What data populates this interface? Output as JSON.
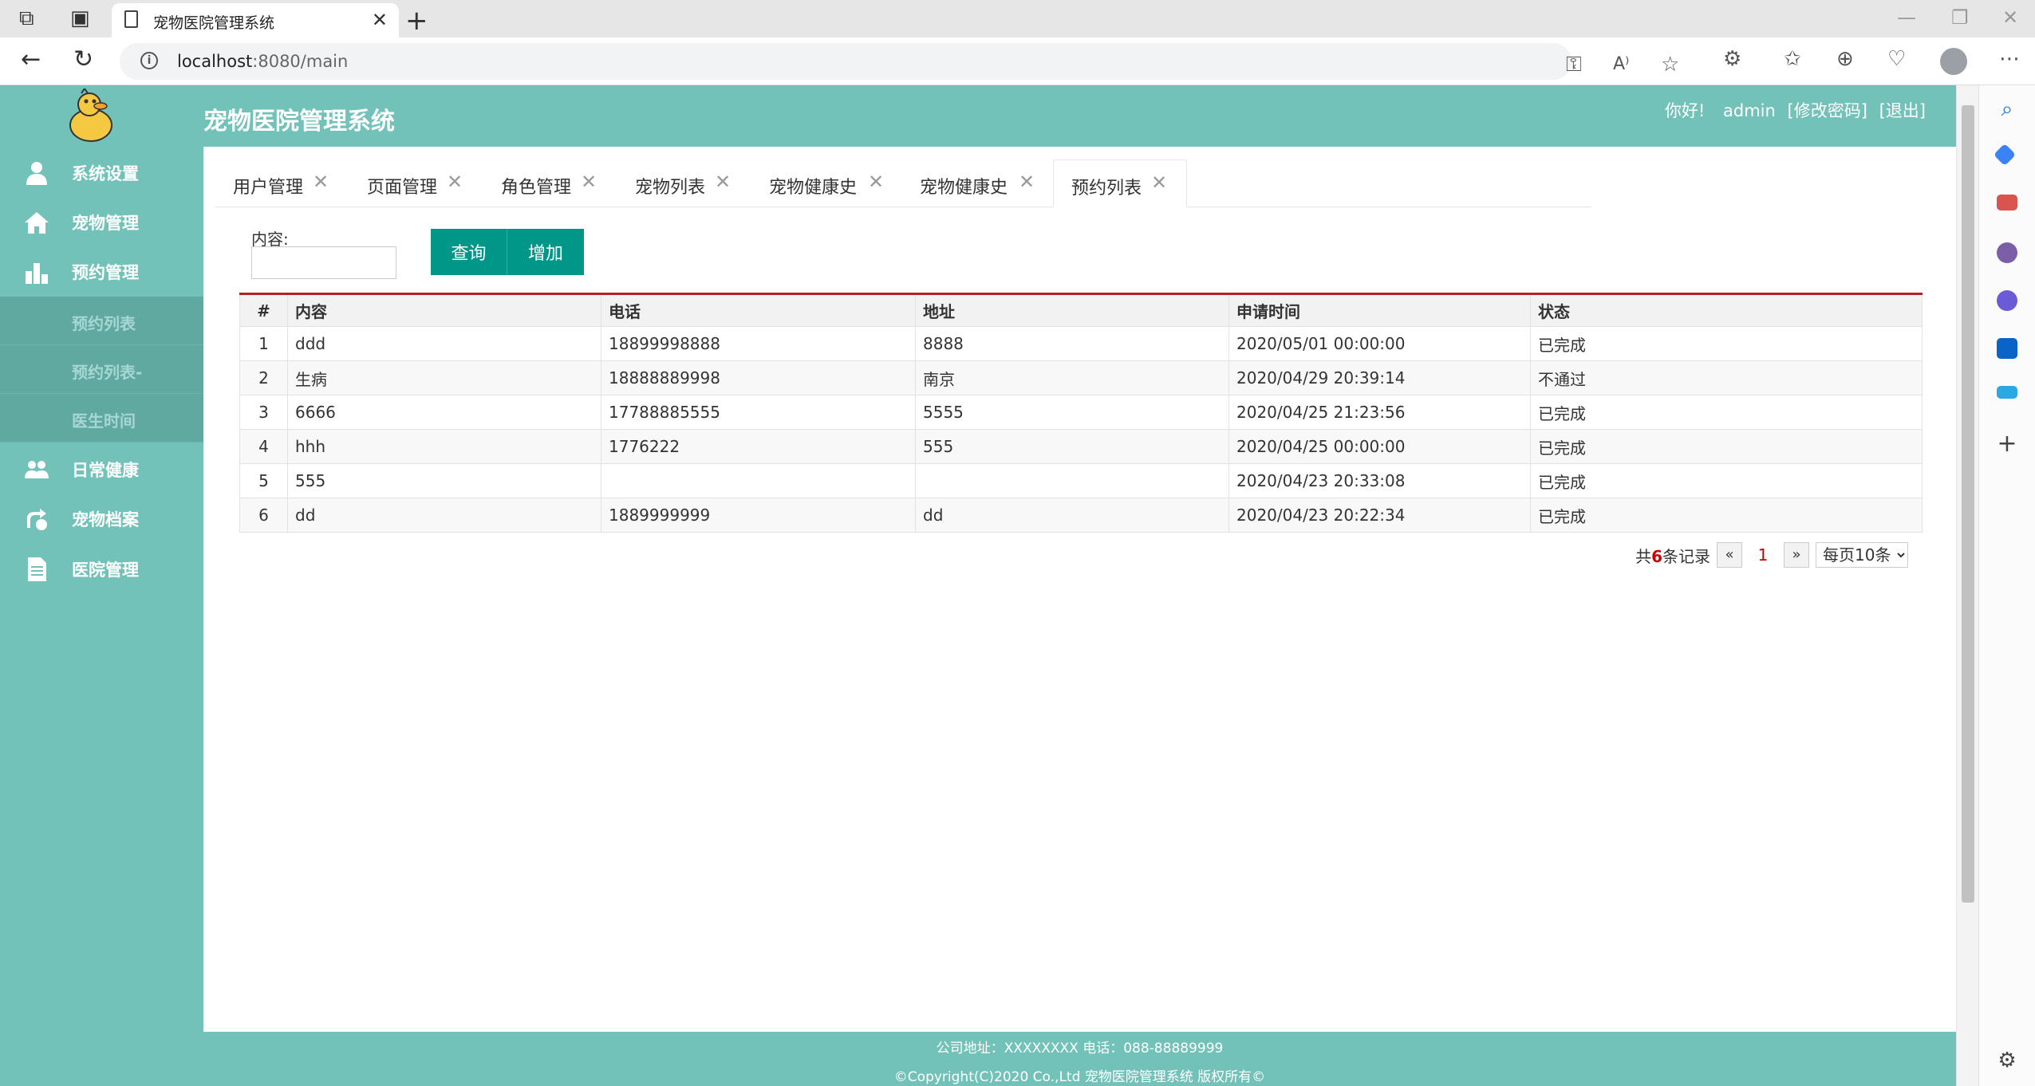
{
  "browser": {
    "tab_title": "宠物医院管理系统",
    "url_host": "localhost",
    "url_rest": ":8080/main"
  },
  "app": {
    "title": "宠物医院管理系统",
    "greeting": "你好!",
    "username": "admin",
    "change_password": "[修改密码]",
    "logout": "[退出]"
  },
  "sidebar": {
    "items": [
      {
        "label": "系统设置",
        "icon": "user-icon"
      },
      {
        "label": "宠物管理",
        "icon": "home-icon"
      },
      {
        "label": "预约管理",
        "icon": "chart-icon"
      },
      {
        "label": "日常健康",
        "icon": "group-icon"
      },
      {
        "label": "宠物档案",
        "icon": "pet-icon"
      },
      {
        "label": "医院管理",
        "icon": "document-icon"
      }
    ],
    "sub_items": [
      {
        "label": "预约列表"
      },
      {
        "label": "预约列表-"
      },
      {
        "label": "医生时间"
      }
    ]
  },
  "tabs": [
    {
      "label": "用户管理"
    },
    {
      "label": "页面管理"
    },
    {
      "label": "角色管理"
    },
    {
      "label": "宠物列表"
    },
    {
      "label": "宠物健康史"
    },
    {
      "label": "宠物健康史"
    },
    {
      "label": "预约列表"
    }
  ],
  "filter": {
    "label": "内容:",
    "value": "",
    "query_button": "查询",
    "add_button": "增加"
  },
  "table": {
    "headers": [
      "#",
      "内容",
      "电话",
      "地址",
      "申请时间",
      "状态"
    ],
    "rows": [
      [
        "1",
        "ddd",
        "18899998888",
        "8888",
        "2020/05/01 00:00:00",
        "已完成"
      ],
      [
        "2",
        "生病",
        "18888889998",
        "南京",
        "2020/04/29 20:39:14",
        "不通过"
      ],
      [
        "3",
        "6666",
        "17788885555",
        "5555",
        "2020/04/25 21:23:56",
        "已完成"
      ],
      [
        "4",
        "hhh",
        "1776222",
        "555",
        "2020/04/25 00:00:00",
        "已完成"
      ],
      [
        "5",
        "555",
        "",
        "",
        "2020/04/23 20:33:08",
        "已完成"
      ],
      [
        "6",
        "dd",
        "1889999999",
        "dd",
        "2020/04/23 20:22:34",
        "已完成"
      ]
    ]
  },
  "pager": {
    "total_prefix": "共",
    "total_count": "6",
    "total_suffix": "条记录",
    "prev": "«",
    "current_page": "1",
    "next": "»",
    "page_size": "每页10条"
  },
  "footer": {
    "line1": "公司地址：XXXXXXXX 电话：088-88889999",
    "line2": "©Copyright(C)2020 Co.,Ltd 宠物医院管理系统 版权所有©"
  },
  "colors": {
    "theme": "#73c2b9",
    "button": "#009688",
    "table_top_border": "#b22222"
  }
}
